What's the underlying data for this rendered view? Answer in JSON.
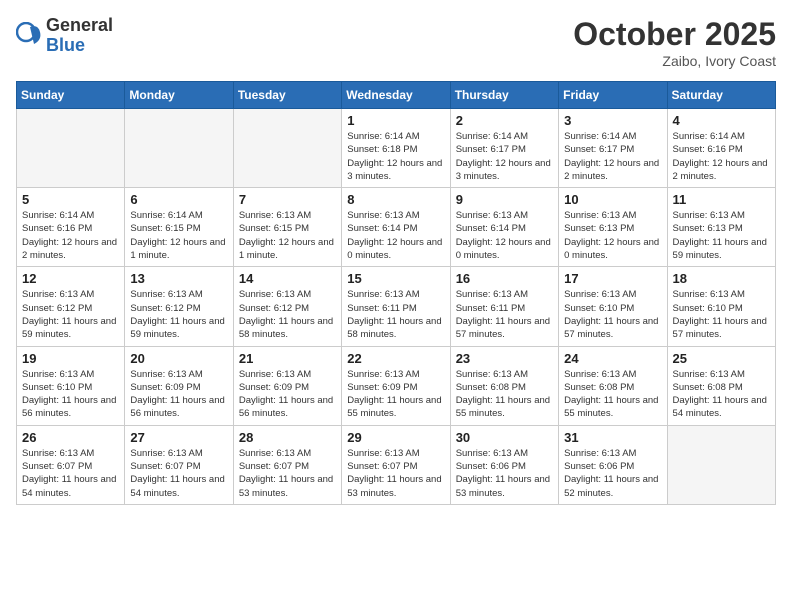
{
  "logo": {
    "general": "General",
    "blue": "Blue"
  },
  "header": {
    "month": "October 2025",
    "location": "Zaibo, Ivory Coast"
  },
  "weekdays": [
    "Sunday",
    "Monday",
    "Tuesday",
    "Wednesday",
    "Thursday",
    "Friday",
    "Saturday"
  ],
  "weeks": [
    [
      {
        "day": "",
        "detail": ""
      },
      {
        "day": "",
        "detail": ""
      },
      {
        "day": "",
        "detail": ""
      },
      {
        "day": "1",
        "detail": "Sunrise: 6:14 AM\nSunset: 6:18 PM\nDaylight: 12 hours and 3 minutes."
      },
      {
        "day": "2",
        "detail": "Sunrise: 6:14 AM\nSunset: 6:17 PM\nDaylight: 12 hours and 3 minutes."
      },
      {
        "day": "3",
        "detail": "Sunrise: 6:14 AM\nSunset: 6:17 PM\nDaylight: 12 hours and 2 minutes."
      },
      {
        "day": "4",
        "detail": "Sunrise: 6:14 AM\nSunset: 6:16 PM\nDaylight: 12 hours and 2 minutes."
      }
    ],
    [
      {
        "day": "5",
        "detail": "Sunrise: 6:14 AM\nSunset: 6:16 PM\nDaylight: 12 hours and 2 minutes."
      },
      {
        "day": "6",
        "detail": "Sunrise: 6:14 AM\nSunset: 6:15 PM\nDaylight: 12 hours and 1 minute."
      },
      {
        "day": "7",
        "detail": "Sunrise: 6:13 AM\nSunset: 6:15 PM\nDaylight: 12 hours and 1 minute."
      },
      {
        "day": "8",
        "detail": "Sunrise: 6:13 AM\nSunset: 6:14 PM\nDaylight: 12 hours and 0 minutes."
      },
      {
        "day": "9",
        "detail": "Sunrise: 6:13 AM\nSunset: 6:14 PM\nDaylight: 12 hours and 0 minutes."
      },
      {
        "day": "10",
        "detail": "Sunrise: 6:13 AM\nSunset: 6:13 PM\nDaylight: 12 hours and 0 minutes."
      },
      {
        "day": "11",
        "detail": "Sunrise: 6:13 AM\nSunset: 6:13 PM\nDaylight: 11 hours and 59 minutes."
      }
    ],
    [
      {
        "day": "12",
        "detail": "Sunrise: 6:13 AM\nSunset: 6:12 PM\nDaylight: 11 hours and 59 minutes."
      },
      {
        "day": "13",
        "detail": "Sunrise: 6:13 AM\nSunset: 6:12 PM\nDaylight: 11 hours and 59 minutes."
      },
      {
        "day": "14",
        "detail": "Sunrise: 6:13 AM\nSunset: 6:12 PM\nDaylight: 11 hours and 58 minutes."
      },
      {
        "day": "15",
        "detail": "Sunrise: 6:13 AM\nSunset: 6:11 PM\nDaylight: 11 hours and 58 minutes."
      },
      {
        "day": "16",
        "detail": "Sunrise: 6:13 AM\nSunset: 6:11 PM\nDaylight: 11 hours and 57 minutes."
      },
      {
        "day": "17",
        "detail": "Sunrise: 6:13 AM\nSunset: 6:10 PM\nDaylight: 11 hours and 57 minutes."
      },
      {
        "day": "18",
        "detail": "Sunrise: 6:13 AM\nSunset: 6:10 PM\nDaylight: 11 hours and 57 minutes."
      }
    ],
    [
      {
        "day": "19",
        "detail": "Sunrise: 6:13 AM\nSunset: 6:10 PM\nDaylight: 11 hours and 56 minutes."
      },
      {
        "day": "20",
        "detail": "Sunrise: 6:13 AM\nSunset: 6:09 PM\nDaylight: 11 hours and 56 minutes."
      },
      {
        "day": "21",
        "detail": "Sunrise: 6:13 AM\nSunset: 6:09 PM\nDaylight: 11 hours and 56 minutes."
      },
      {
        "day": "22",
        "detail": "Sunrise: 6:13 AM\nSunset: 6:09 PM\nDaylight: 11 hours and 55 minutes."
      },
      {
        "day": "23",
        "detail": "Sunrise: 6:13 AM\nSunset: 6:08 PM\nDaylight: 11 hours and 55 minutes."
      },
      {
        "day": "24",
        "detail": "Sunrise: 6:13 AM\nSunset: 6:08 PM\nDaylight: 11 hours and 55 minutes."
      },
      {
        "day": "25",
        "detail": "Sunrise: 6:13 AM\nSunset: 6:08 PM\nDaylight: 11 hours and 54 minutes."
      }
    ],
    [
      {
        "day": "26",
        "detail": "Sunrise: 6:13 AM\nSunset: 6:07 PM\nDaylight: 11 hours and 54 minutes."
      },
      {
        "day": "27",
        "detail": "Sunrise: 6:13 AM\nSunset: 6:07 PM\nDaylight: 11 hours and 54 minutes."
      },
      {
        "day": "28",
        "detail": "Sunrise: 6:13 AM\nSunset: 6:07 PM\nDaylight: 11 hours and 53 minutes."
      },
      {
        "day": "29",
        "detail": "Sunrise: 6:13 AM\nSunset: 6:07 PM\nDaylight: 11 hours and 53 minutes."
      },
      {
        "day": "30",
        "detail": "Sunrise: 6:13 AM\nSunset: 6:06 PM\nDaylight: 11 hours and 53 minutes."
      },
      {
        "day": "31",
        "detail": "Sunrise: 6:13 AM\nSunset: 6:06 PM\nDaylight: 11 hours and 52 minutes."
      },
      {
        "day": "",
        "detail": ""
      }
    ]
  ]
}
